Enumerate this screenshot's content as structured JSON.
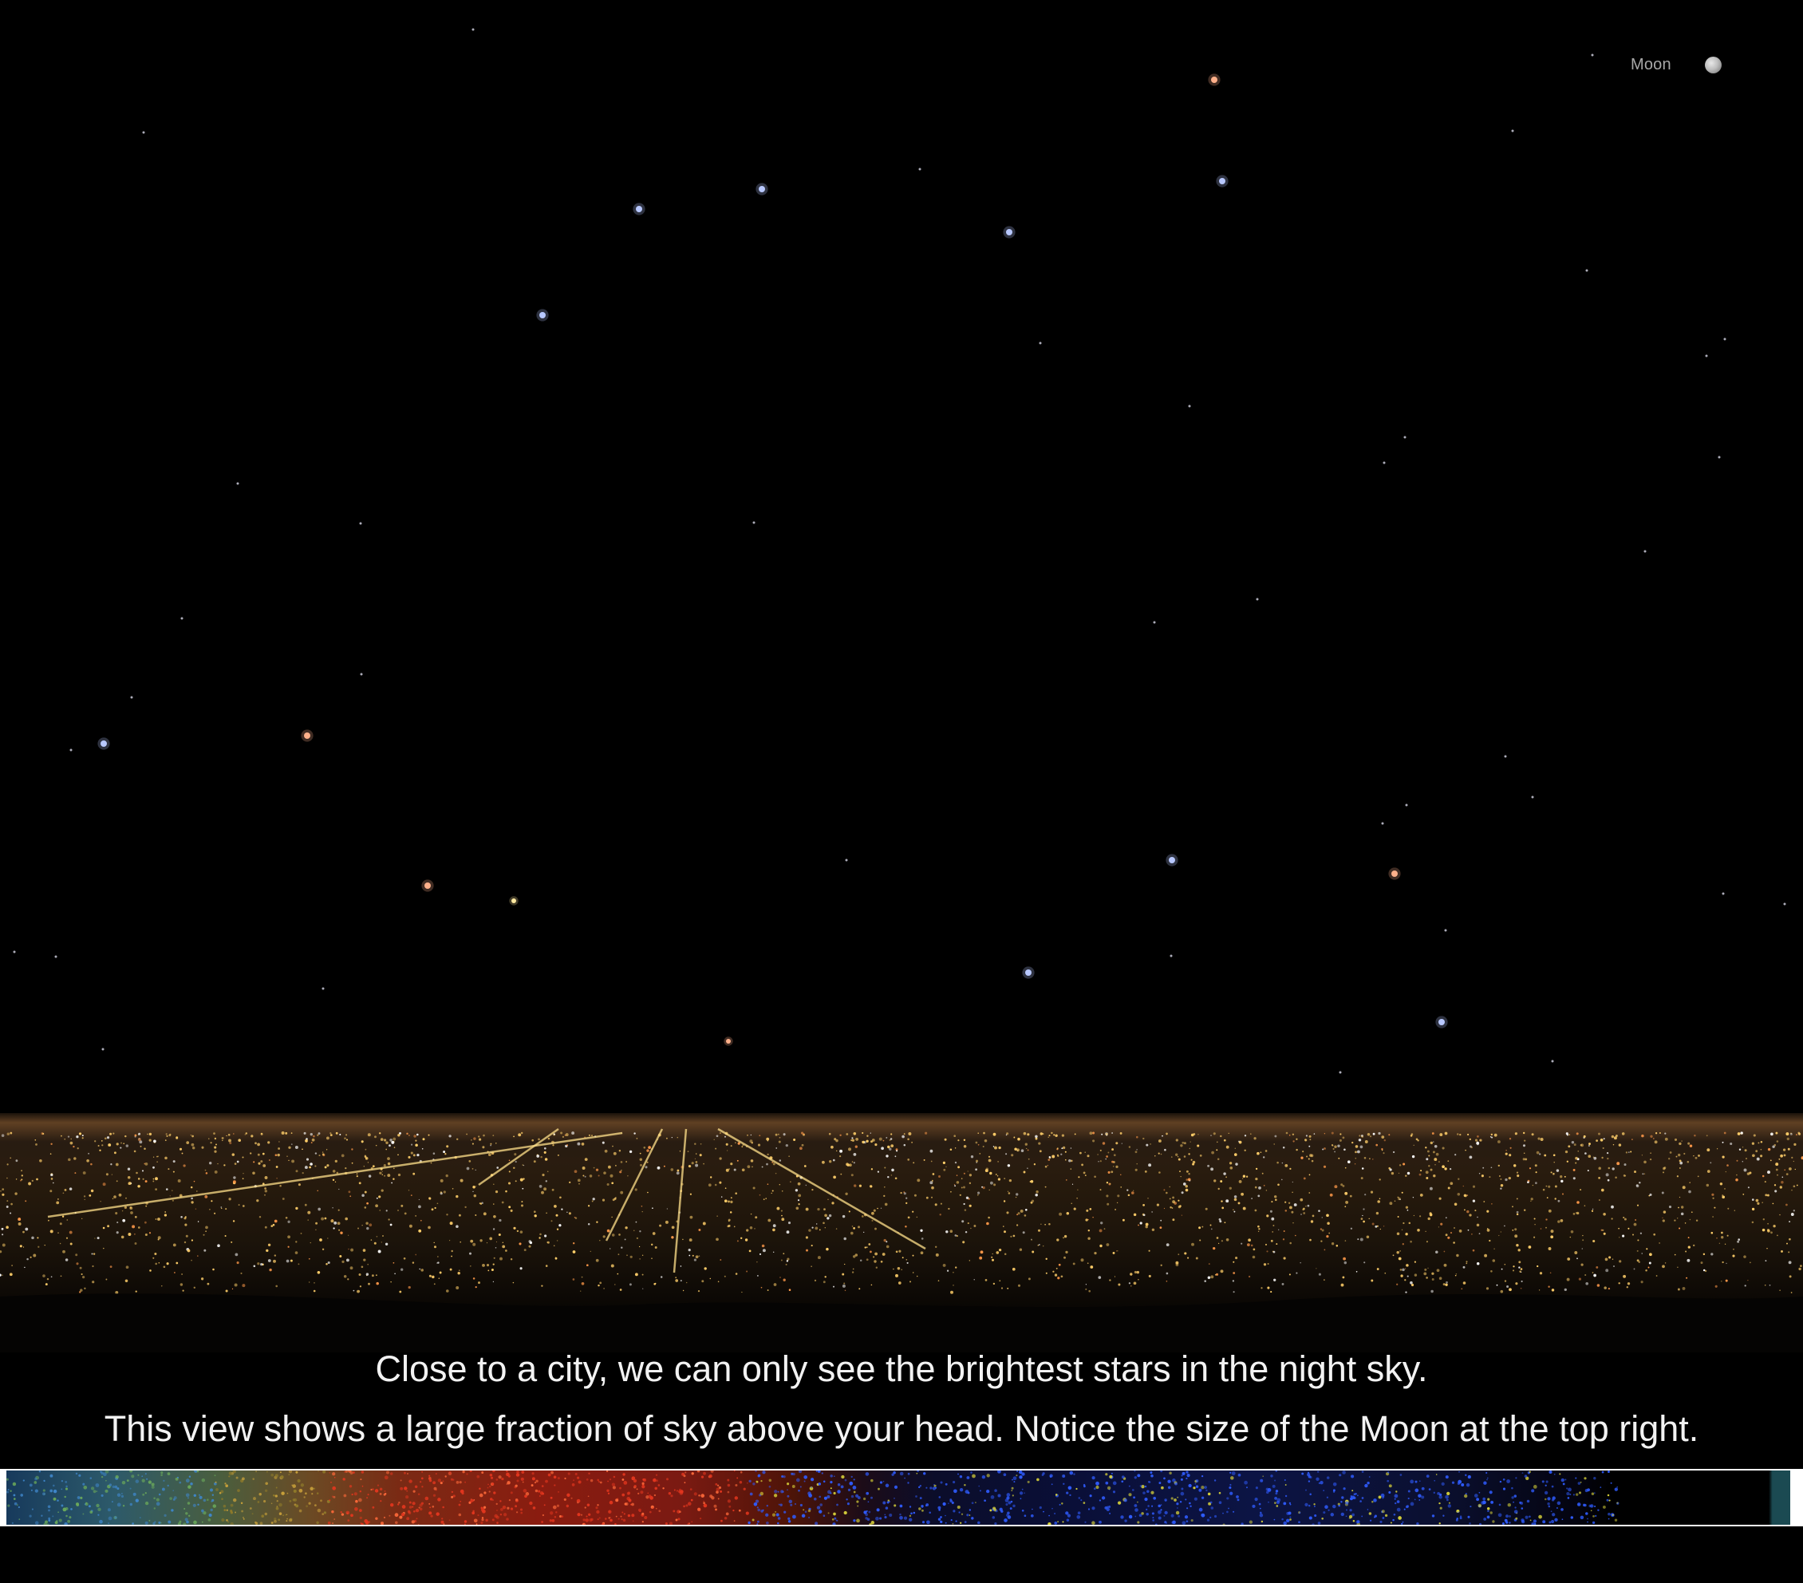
{
  "moon": {
    "label": "Moon",
    "icon": "moon-icon"
  },
  "caption": {
    "line1": "Close to a city, we can only see the brightest stars in the night sky.",
    "line2": "This view shows a large fraction of sky above your head. Notice the size of the Moon at the top right."
  },
  "colors": {
    "background": "#000000",
    "caption_text": "#f2f2f2",
    "moon_label": "#a8a8a8",
    "star_blue": "#b8c8ff",
    "star_orange": "#ffb08a",
    "city_light": "#ffcf6a"
  }
}
